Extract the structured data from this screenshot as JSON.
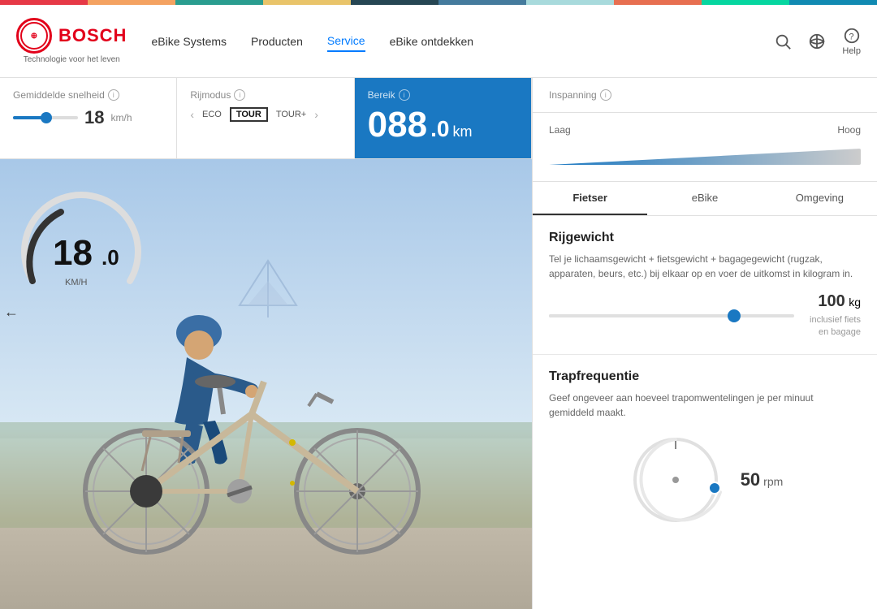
{
  "colorbar": {
    "label": "colorbar"
  },
  "header": {
    "logo": {
      "brand": "BOSCH",
      "tagline": "Technologie voor het leven"
    },
    "nav": {
      "items": [
        {
          "label": "eBike Systems",
          "active": false
        },
        {
          "label": "Producten",
          "active": false
        },
        {
          "label": "Service",
          "active": true
        },
        {
          "label": "eBike ontdekken",
          "active": false
        }
      ]
    },
    "actions": {
      "search_label": "search",
      "language_label": "language",
      "help_label": "Help"
    }
  },
  "controls": {
    "gemiddelde_snelheid": {
      "label": "Gemiddelde snelheid",
      "value": "18",
      "unit": "km/h"
    },
    "rijmodus": {
      "label": "Rijmodus",
      "modes": [
        "ECO",
        "TOUR",
        "TOUR+"
      ],
      "active_mode": "TOUR"
    },
    "bereik": {
      "label": "Bereik",
      "value": "088",
      "decimal": ".0",
      "unit": "km"
    }
  },
  "speedometer": {
    "value": "18",
    "decimal": ".0",
    "unit": "KM/H"
  },
  "right_panel": {
    "inspanning": {
      "label": "Inspanning",
      "laag": "Laag",
      "hoog": "Hoog"
    },
    "tabs": [
      {
        "label": "Fietser",
        "active": true
      },
      {
        "label": "eBike",
        "active": false
      },
      {
        "label": "Omgeving",
        "active": false
      }
    ],
    "rijgewicht": {
      "title": "Rijgewicht",
      "description": "Tel je lichaamsgewicht + fietsgewicht + bagagegewicht (rugzak, apparaten, beurs, etc.) bij elkaar op en voer de uitkomst in kilogram in.",
      "value": "100",
      "unit": "kg",
      "note_line1": "inclusief fiets",
      "note_line2": "en bagage"
    },
    "trapfrequentie": {
      "title": "Trapfrequentie",
      "description": "Geef ongeveer aan hoeveel trapomwentelingen je per minuut gemiddeld maakt.",
      "value": "50",
      "unit": "rpm"
    }
  }
}
